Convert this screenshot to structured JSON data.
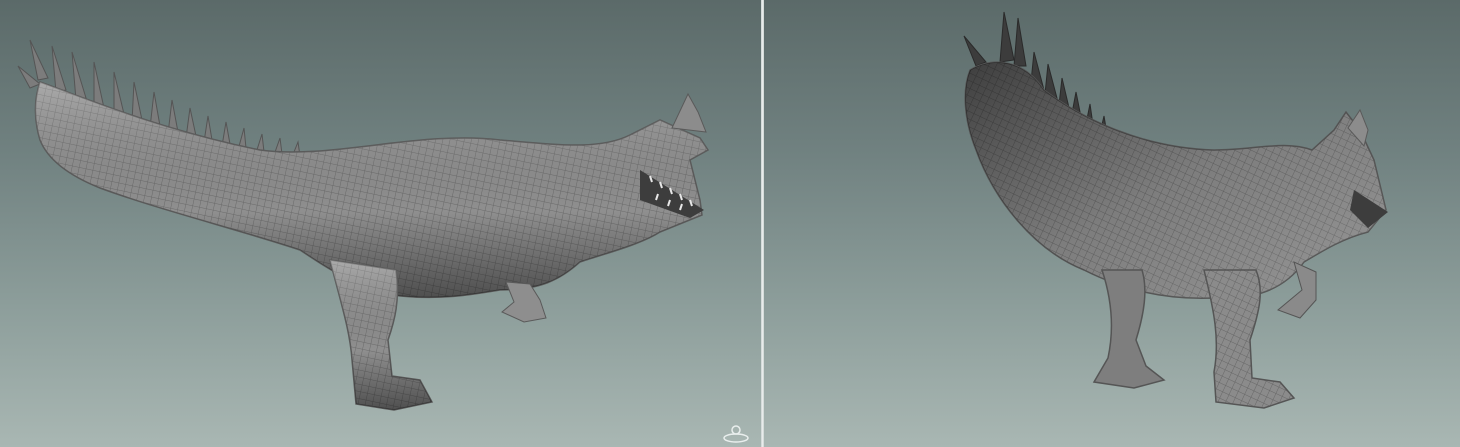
{
  "workspace": {
    "layout": "split-view",
    "background_top": "#5b6a69",
    "background_bottom": "#a9b7b3",
    "divider_color": "#e6ebea",
    "model_color": "#9a9a9a"
  },
  "viewports": [
    {
      "name": "side-view",
      "subject": "dinosaur-sculpt-side",
      "icon": "navigation-gizmo-icon"
    },
    {
      "name": "three-quarter-view",
      "subject": "dinosaur-sculpt-rear-three-quarter"
    }
  ]
}
